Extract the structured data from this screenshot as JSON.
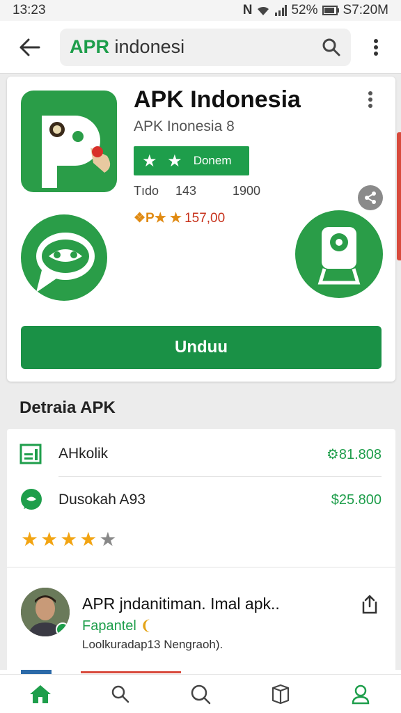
{
  "status_bar": {
    "time": "13:23",
    "notif": "N",
    "battery": "52%",
    "right_time": "S7:20M"
  },
  "search": {
    "prefix": "APR",
    "query": " indonesi"
  },
  "app": {
    "title": "APK Indonesia",
    "subtitle": "APK Inonesia 8",
    "rating_stars": "★ ★",
    "rating_label": "Donem",
    "meta_left": "Tıdo",
    "meta_mid": "143",
    "meta_right": "1900",
    "price_icon": "❖P★ ★",
    "price": "157,00",
    "install_label": "Unduu",
    "colors": {
      "primary": "#1e9e4b",
      "icon_bg": "#2a9d48",
      "button": "#1a9146"
    }
  },
  "details": {
    "section_title": "Detraia  APK",
    "row1": {
      "label": "AHkolik",
      "amount": "⚙︎81.808"
    },
    "row2": {
      "label": "Dusokah A93",
      "amount": "$25.800"
    },
    "stars_on": "★★★★",
    "stars_off": "★",
    "rating": 4
  },
  "review": {
    "title": "APR jndanitiman. Imal apk..",
    "subtitle": "Fapantel",
    "subtitle_emoji": "❨",
    "body": "Loolkuradap13 Nengraoh)."
  },
  "nav": {
    "items": [
      "home",
      "search",
      "search",
      "box",
      "account"
    ]
  }
}
